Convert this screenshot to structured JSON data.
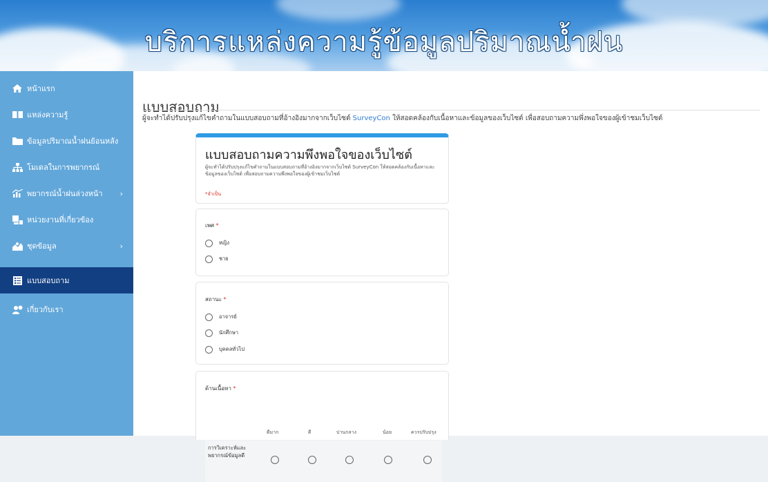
{
  "banner": {
    "title": "บริการแหล่งความรู้ข้อมูลปริมาณน้ำฝน"
  },
  "sidebar": {
    "items": [
      {
        "label": "หน้าแรก",
        "icon": "home-icon",
        "active": false
      },
      {
        "label": "แหล่งความรู้",
        "icon": "book-icon",
        "active": false
      },
      {
        "label": "ข้อมูลปริมาณน้ำฝนย้อนหลัง",
        "icon": "folder-icon",
        "active": false
      },
      {
        "label": "โมเดลในการพยากรณ์",
        "icon": "sitemap-icon",
        "active": false
      },
      {
        "label": "พยากรณ์น้ำฝนล่วงหน้า",
        "icon": "chart-icon",
        "active": false,
        "has_submenu": true
      },
      {
        "label": "หน่วยงานที่เกี่ยวข้อง",
        "icon": "org-icon",
        "active": false
      },
      {
        "label": "ชุดข้อมูล",
        "icon": "dataset-icon",
        "active": false,
        "has_submenu": true
      },
      {
        "label": "แบบสอบถาม",
        "icon": "survey-icon",
        "active": true
      },
      {
        "label": "เกี่ยวกับเรา",
        "icon": "about-icon",
        "active": false
      }
    ],
    "chevron": "›"
  },
  "main": {
    "title": "แบบสอบถาม",
    "intro_before": "ผู้จะทำได้ปรับปรุงแก้ไขคำถามในแบบสอบถามที่อ้างอิงมากจากเว็บไซต์ ",
    "intro_link": "SurveyCon",
    "intro_after": " ให้สอดคล้องกับเนื้อหาและข้อมูลของเว็บไซต์ เพื่อสอบถามความพึ่งพอใจของผู้เข้าชมเว็บไซต์"
  },
  "form": {
    "title": "แบบสอบถามความพึงพอใจของเว็บไซต์",
    "description": "ผู้จะทำได้ปรับปรุงแก้ไขคำถามในแบบสอบถามที่อ้างอิงมากจากเว็บไซต์ SurveyCon ให้สอดคล้องกับเนื้อหาและข้อมูลของเว็บไซต์ เพื่อสอบถามความพึงพอใจของผู้เข้าชมเว็บไซต์",
    "required_note": "*จำเป็น",
    "q1": {
      "label": "เพศ",
      "star": "*",
      "options": [
        "หญิง",
        "ชาย"
      ]
    },
    "q2": {
      "label": "สถานะ",
      "star": "*",
      "options": [
        "อาจารย์",
        "นักศึกษา",
        "บุคคลทั่วไป"
      ]
    },
    "q3": {
      "label": "ด้านเนื้อหา",
      "star": "*",
      "columns": [
        "ดีมาก",
        "ดี",
        "ปานกลาง",
        "น้อย",
        "ควรปรับปรุง"
      ],
      "row_label": "การวิเคราะห์และพยากรณ์ข้อมูลดี"
    }
  },
  "colors": {
    "sidebar": "#62a7da",
    "active": "#123f82",
    "accent": "#2f9be5",
    "required": "#d93025"
  }
}
